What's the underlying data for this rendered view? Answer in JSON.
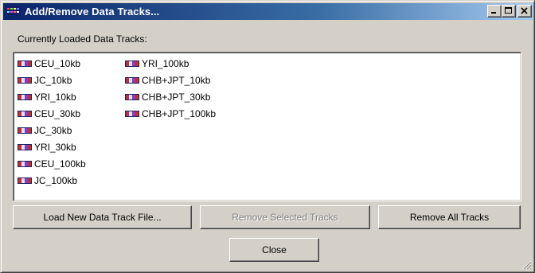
{
  "window": {
    "title": "Add/Remove Data Tracks...",
    "minimize_glyph": "minimize-icon",
    "maximize_glyph": "maximize-icon",
    "close_glyph": "close-icon"
  },
  "loaded_label": "Currently Loaded Data Tracks:",
  "tracks": {
    "column1": [
      "CEU_10kb",
      "JC_10kb",
      "YRI_10kb",
      "CEU_30kb",
      "JC_30kb",
      "YRI_30kb",
      "CEU_100kb",
      "JC_100kb"
    ],
    "column2": [
      "YRI_100kb",
      "CHB+JPT_10kb",
      "CHB+JPT_30kb",
      "CHB+JPT_100kb"
    ]
  },
  "buttons": {
    "load": "Load New Data Track File...",
    "remove_selected": "Remove Selected Tracks",
    "remove_all": "Remove All Tracks",
    "close": "Close"
  },
  "icons": {
    "app": "data-track-app-icon",
    "track": "data-track-icon",
    "resize": "resize-grip-icon"
  },
  "colors": {
    "title_start": "#0a246a",
    "title_end": "#a6caf0",
    "face": "#d4d0c8",
    "disabled_text": "#808080"
  }
}
